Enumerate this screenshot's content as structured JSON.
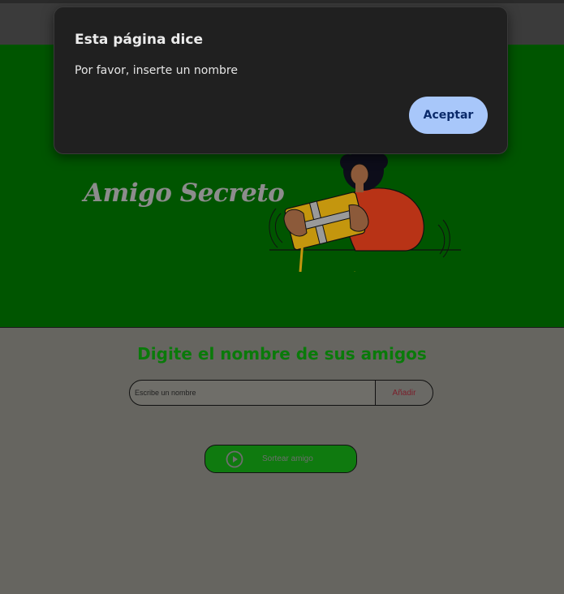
{
  "header": {
    "title": "Amigo Secreto"
  },
  "main": {
    "section_title": "Digite el nombre de sus amigos",
    "input_placeholder": "Escribe un nombre",
    "add_button_label": "Añadir",
    "draw_button_label": "Sortear amigo"
  },
  "dialog": {
    "title": "Esta página dice",
    "message": "Por favor, inserte un nombre",
    "ok_label": "Aceptar"
  },
  "colors": {
    "header_background": "#005500",
    "title_green": "#0a7a0a",
    "dialog_button": "#a8c7fa"
  },
  "icons": {
    "draw_button_icon": "play-circle-icon",
    "illustration": "person-holding-gift-box"
  }
}
